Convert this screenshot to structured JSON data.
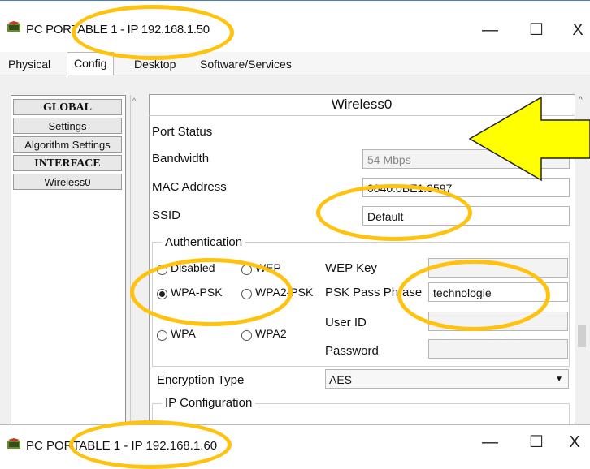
{
  "window": {
    "title": "PC PORTABLE 1 - IP 192.168.1.50",
    "controls": {
      "minimize": "—",
      "maximize": "☐",
      "close": "X"
    }
  },
  "tabs": [
    {
      "label": "Physical"
    },
    {
      "label": "Config"
    },
    {
      "label": "Desktop"
    },
    {
      "label": "Software/Services"
    }
  ],
  "sidebar": {
    "items": [
      {
        "label": "GLOBAL"
      },
      {
        "label": "Settings"
      },
      {
        "label": "Algorithm Settings"
      },
      {
        "label": "INTERFACE"
      },
      {
        "label": "Wireless0"
      }
    ]
  },
  "panel": {
    "title": "Wireless0",
    "port_status_label": "Port Status",
    "bandwidth_label": "Bandwidth",
    "bandwidth_value": "54 Mbps",
    "mac_label": "MAC Address",
    "mac_value": "0040.0BE1.0597",
    "ssid_label": "SSID",
    "ssid_value": "Default",
    "auth": {
      "legend": "Authentication",
      "options": [
        "Disabled",
        "WEP",
        "WPA-PSK",
        "WPA2-PSK",
        "WPA",
        "WPA2"
      ],
      "selected": "WPA-PSK",
      "wep_key_label": "WEP Key",
      "psk_label": "PSK Pass Phrase",
      "psk_value": "technologie",
      "user_id_label": "User ID",
      "password_label": "Password"
    },
    "encryption_label": "Encryption Type",
    "encryption_value": "AES",
    "ip_config_legend": "IP Configuration"
  },
  "second_window": {
    "title": "PC PORTABLE 1 - IP 192.168.1.60",
    "controls": {
      "minimize": "—",
      "maximize": "☐",
      "close": "X"
    }
  },
  "annotation_colors": {
    "ellipse": "#ffc20e",
    "arrow": "#ffff00"
  }
}
